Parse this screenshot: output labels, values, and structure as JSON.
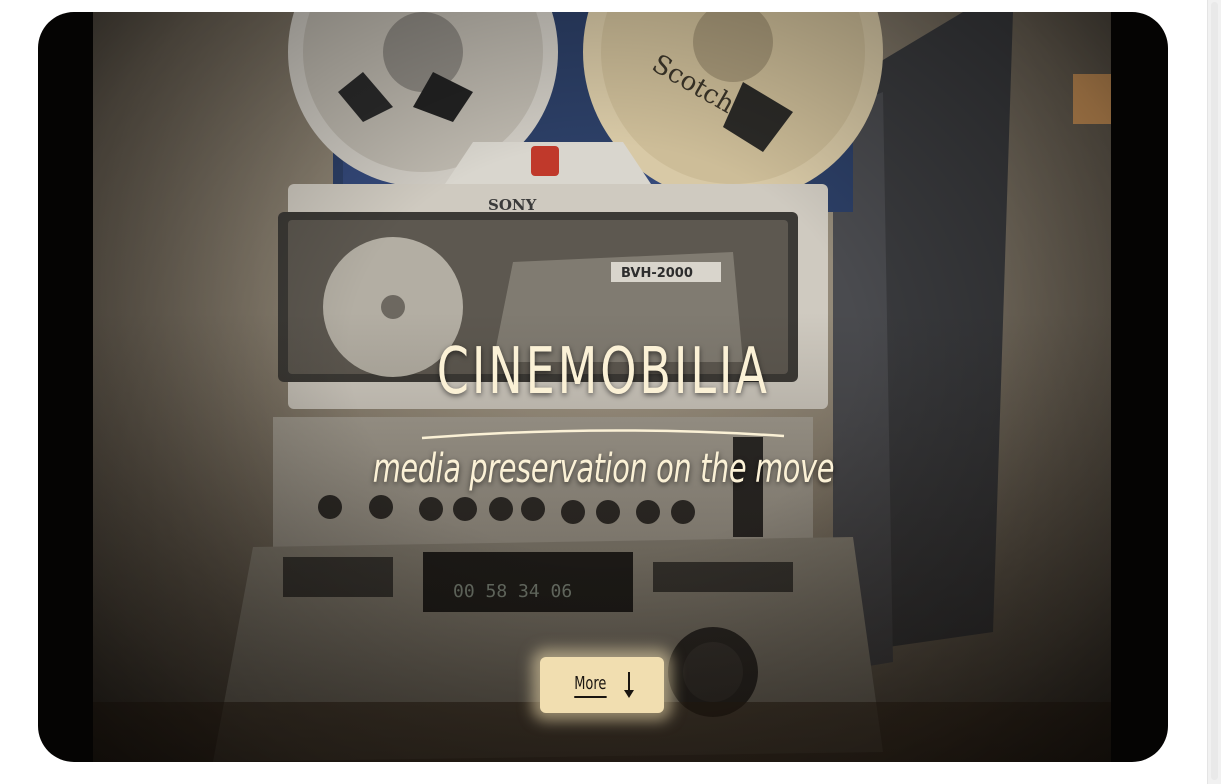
{
  "hero": {
    "brand": "CINEMOBILIA",
    "tagline": "media preservation on the move",
    "more_label": "More",
    "arrow_icon": "arrow-down-icon",
    "accent": "#fbf1d6",
    "button_color": "#f1deb0"
  },
  "photo": {
    "machine_brand": "SONY",
    "model": "BVH-2000",
    "reel_label": "Scotch",
    "counter": "00 58 34 06"
  }
}
